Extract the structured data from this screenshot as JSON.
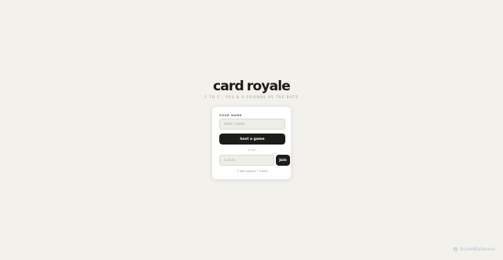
{
  "brand": {
    "logo_left": "card",
    "logo_right": "royale",
    "tagline": "2 TO 5 · YOU & 4 FRIENDS VS THE BOTS"
  },
  "form": {
    "name_label": "YOUR NAME",
    "name_placeholder": "enter name",
    "name_value": "",
    "host_label": "host a game",
    "divider_text": "or join",
    "code_placeholder": "CODE",
    "code_value": "",
    "join_label": "Join",
    "meta_text": "2 real players • 2 bots"
  },
  "watermark": {
    "text": "ScanMalware",
    "icon": "shield-scan-icon"
  },
  "colors": {
    "background": "#f3f1ec",
    "card": "#ffffff",
    "button": "#1d1c1a",
    "input": "#efede8"
  }
}
